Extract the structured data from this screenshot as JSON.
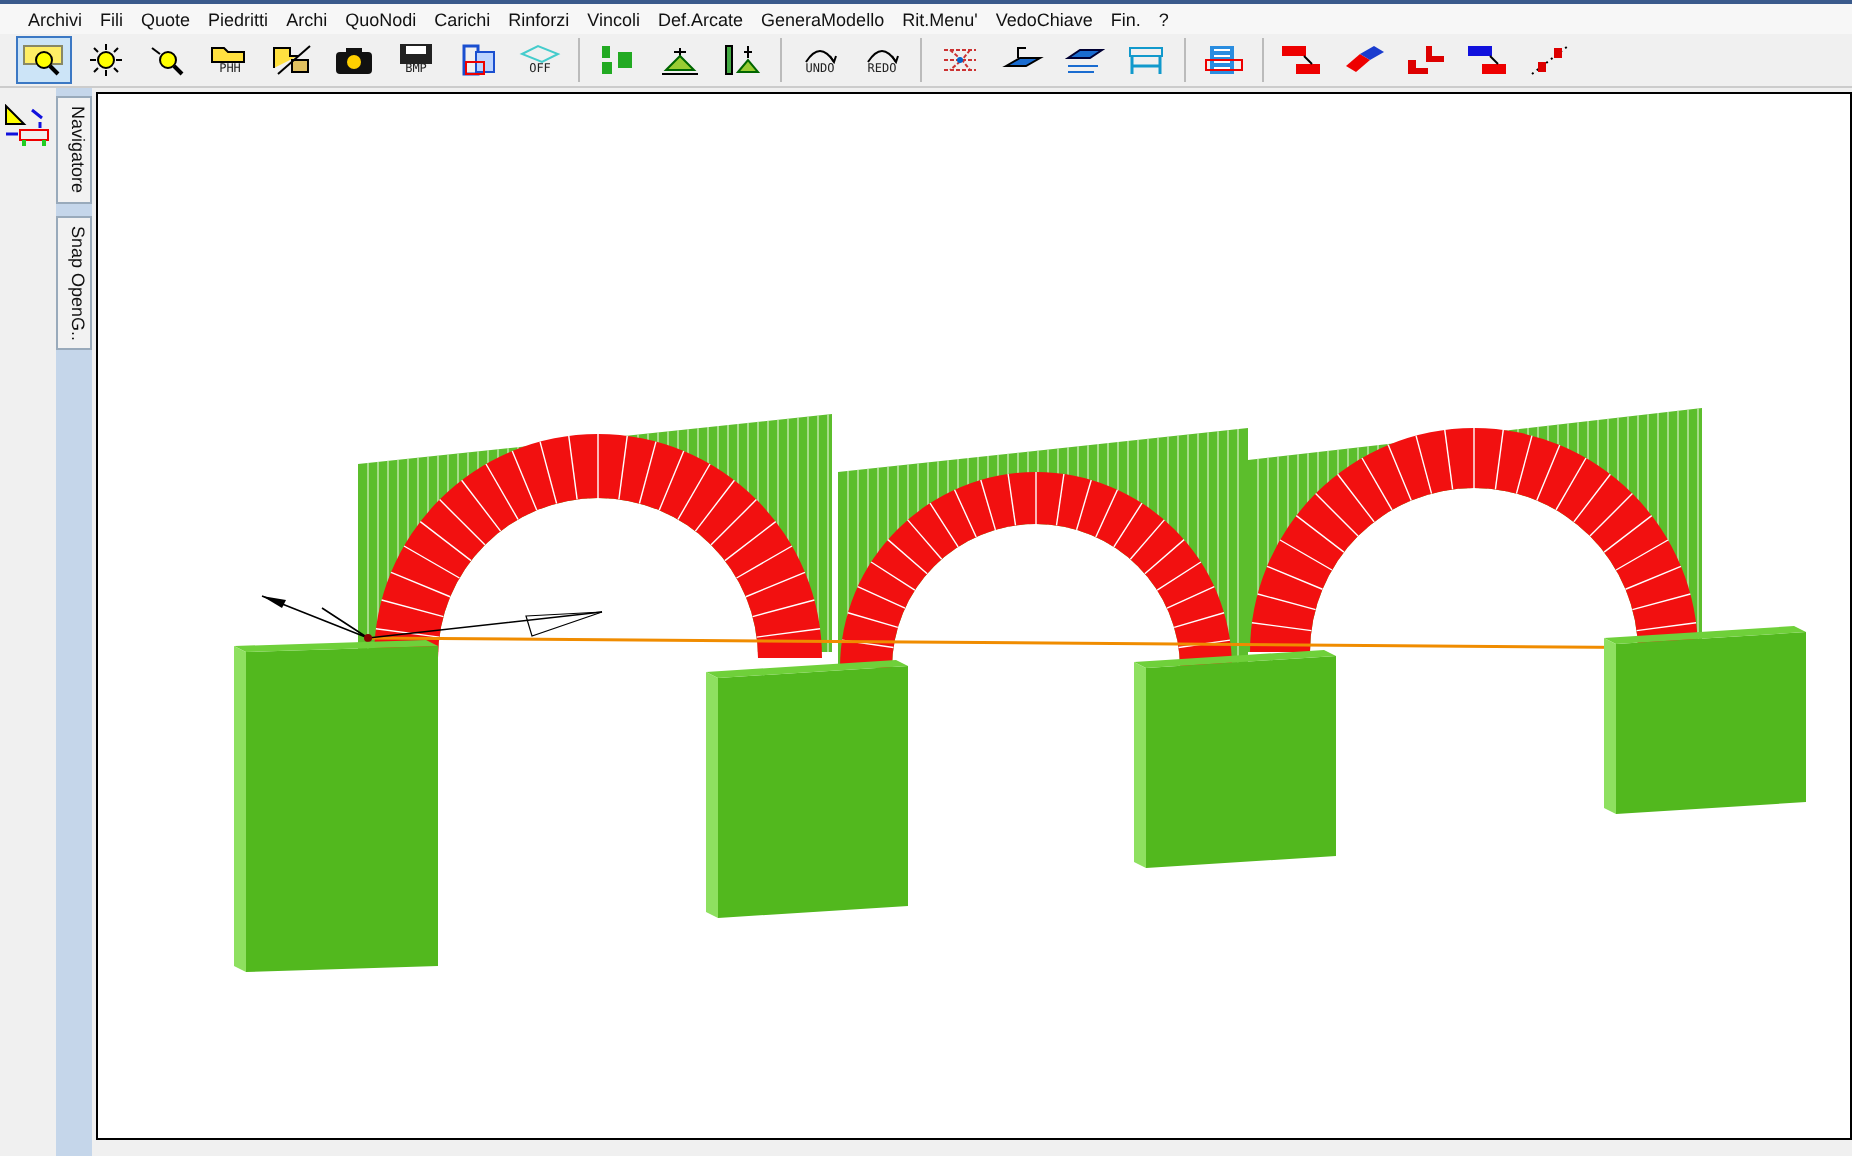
{
  "menu": [
    "Archivi",
    "Fili",
    "Quote",
    "Piedritti",
    "Archi",
    "QuoNodi",
    "Carichi",
    "Rinforzi",
    "Vincoli",
    "Def.Arcate",
    "GeneraModello",
    "Rit.Menu'",
    "VedoChiave",
    "Fin.",
    "?"
  ],
  "toolbar": [
    {
      "kind": "zoom-window",
      "selected": true
    },
    {
      "kind": "sun"
    },
    {
      "kind": "magnifier"
    },
    {
      "kind": "folder",
      "label": "PHH"
    },
    {
      "kind": "folder-cube"
    },
    {
      "kind": "camera"
    },
    {
      "kind": "disk",
      "label": "BMP"
    },
    {
      "kind": "windows"
    },
    {
      "kind": "plane",
      "label": "OFF"
    },
    {
      "kind": "separator"
    },
    {
      "kind": "numbers"
    },
    {
      "kind": "support"
    },
    {
      "kind": "support-bar"
    },
    {
      "kind": "separator"
    },
    {
      "kind": "curve",
      "label": "UNDO"
    },
    {
      "kind": "curve",
      "label": "REDO"
    },
    {
      "kind": "separator"
    },
    {
      "kind": "network"
    },
    {
      "kind": "layer"
    },
    {
      "kind": "layers"
    },
    {
      "kind": "frame"
    },
    {
      "kind": "separator"
    },
    {
      "kind": "building"
    },
    {
      "kind": "separator"
    },
    {
      "kind": "red-blocks"
    },
    {
      "kind": "eraser"
    },
    {
      "kind": "corner"
    },
    {
      "kind": "blue-red-blocks"
    },
    {
      "kind": "scatter"
    }
  ],
  "side_tabs": [
    {
      "label": "Navigatore",
      "selected": false
    },
    {
      "label": "Snap OpenG..",
      "selected": false
    }
  ]
}
